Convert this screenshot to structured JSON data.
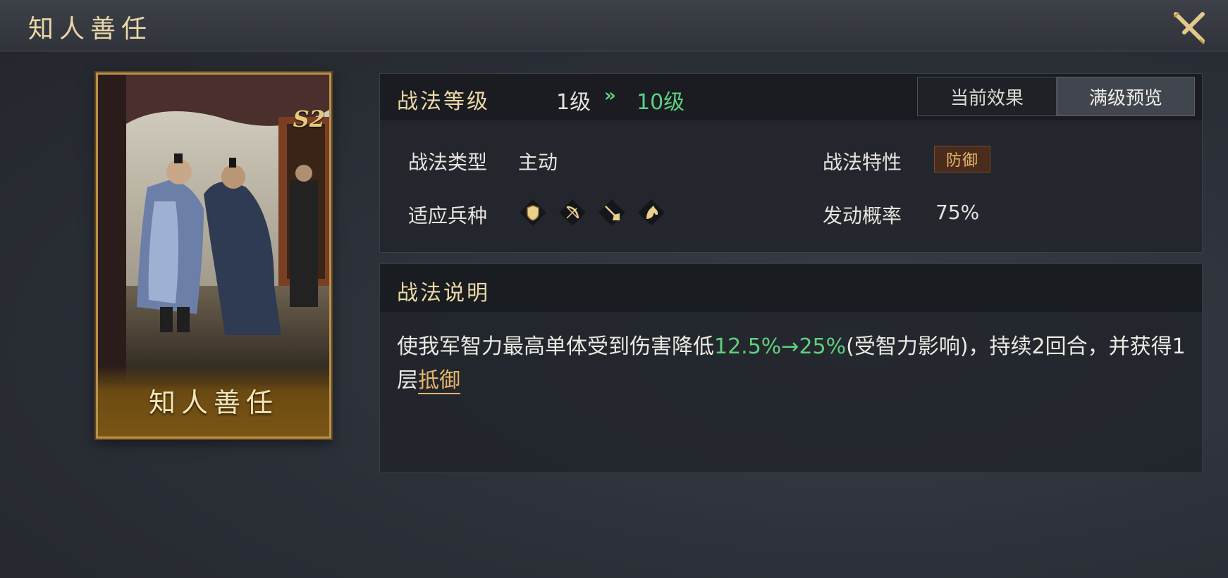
{
  "window": {
    "title": "知人善任"
  },
  "card": {
    "name": "知人善任",
    "season": "S2"
  },
  "info": {
    "level_label": "战法等级",
    "level_from": "1级",
    "level_arrow": "»",
    "level_to": "10级",
    "tabs": [
      {
        "label": "当前效果",
        "selected": false
      },
      {
        "label": "满级预览",
        "selected": true
      }
    ],
    "type_label": "战法类型",
    "type_value": "主动",
    "trait_label": "战法特性",
    "trait_value": "防御",
    "troops_label": "适应兵种",
    "troops": [
      "shield-icon",
      "bow-icon",
      "spear-icon",
      "cavalry-icon"
    ],
    "chance_label": "发动概率",
    "chance_value": "75%"
  },
  "description": {
    "title": "战法说明",
    "text_before": "使我军智力最高单体受到伤害降低",
    "highlight": "12.5%→25%",
    "text_mid": "(受智力影响)，持续2回合，并获得1层",
    "link": "抵御"
  },
  "colors": {
    "accent_gold": "#ecd9a6",
    "green": "#5fcf7e",
    "trait": "#e8b46a"
  }
}
